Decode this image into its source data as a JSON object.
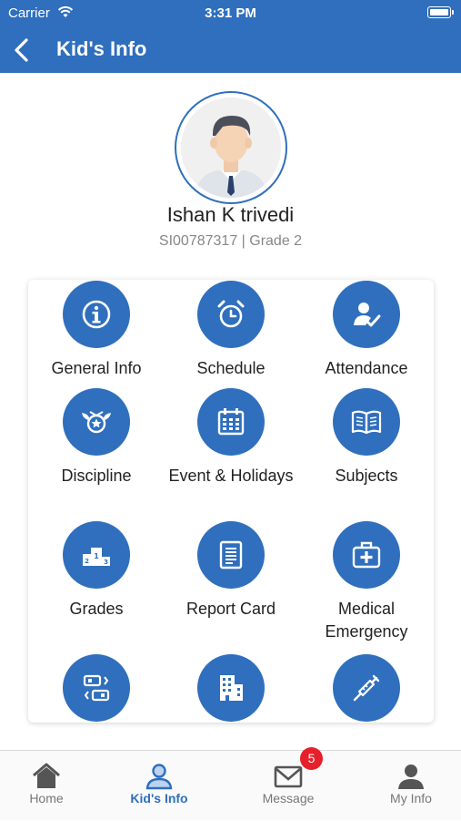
{
  "status_bar": {
    "carrier": "Carrier",
    "time": "3:31 PM"
  },
  "nav": {
    "title": "Kid's Info"
  },
  "profile": {
    "name": "Ishan K trivedi",
    "meta": "SI00787317 | Grade 2"
  },
  "tiles": [
    {
      "label": "General Info",
      "icon": "info-icon"
    },
    {
      "label": "Schedule",
      "icon": "alarm-clock-icon"
    },
    {
      "label": "Attendance",
      "icon": "attendance-icon"
    },
    {
      "label": "Discipline",
      "icon": "badge-star-icon"
    },
    {
      "label": "Event & Holidays",
      "icon": "calendar-icon"
    },
    {
      "label": "Subjects",
      "icon": "book-icon"
    },
    {
      "label": "Grades",
      "icon": "podium-icon"
    },
    {
      "label": "Report Card",
      "icon": "report-card-icon"
    },
    {
      "label": "Medical\nEmergency",
      "icon": "medical-kit-icon"
    },
    {
      "label": "",
      "icon": "bus-pass-icon"
    },
    {
      "label": "",
      "icon": "building-icon"
    },
    {
      "label": "",
      "icon": "syringe-icon"
    }
  ],
  "tab_bar": {
    "items": [
      {
        "label": "Home",
        "icon": "home-icon"
      },
      {
        "label": "Kid's Info",
        "icon": "kid-icon"
      },
      {
        "label": "Message",
        "icon": "mail-icon"
      },
      {
        "label": "My Info",
        "icon": "person-icon"
      }
    ],
    "active": "Kid's Info",
    "message_badge": "5"
  },
  "colors": {
    "primary": "#2f6fbd",
    "badge": "#e5202a"
  }
}
